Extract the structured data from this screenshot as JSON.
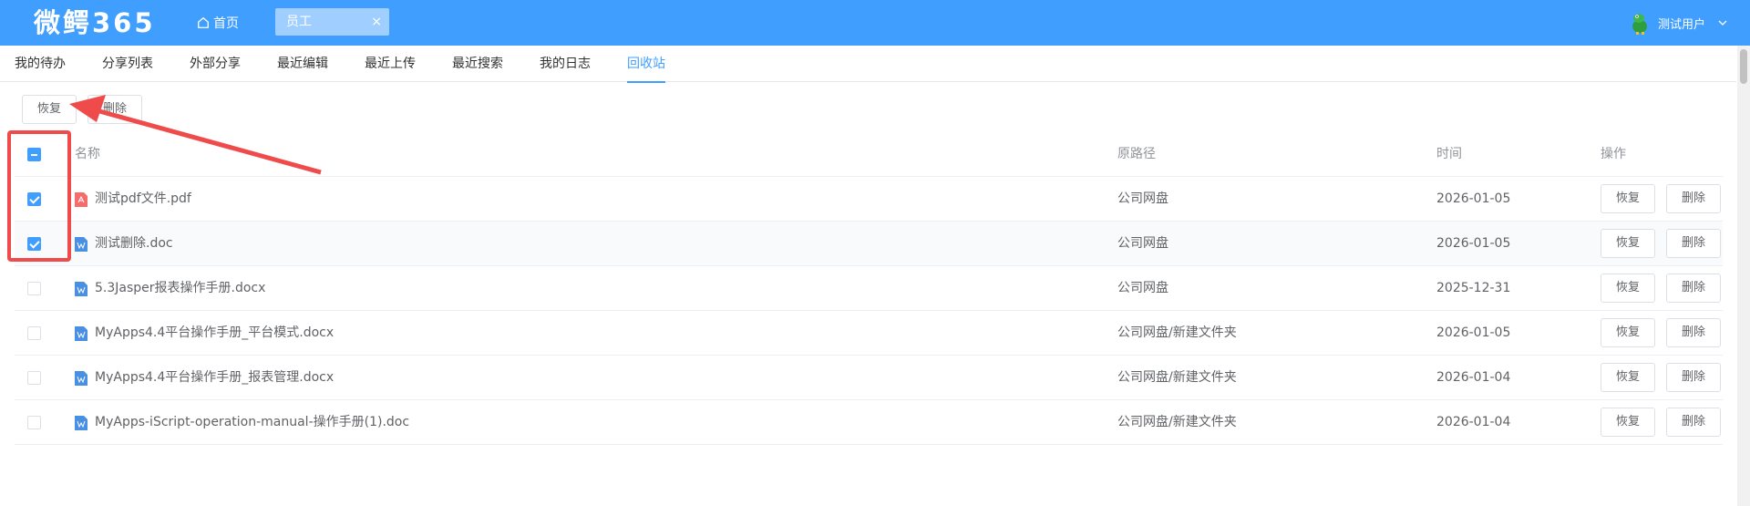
{
  "header": {
    "logo": "微鳄365",
    "home_label": "首页",
    "open_tab": {
      "label": "员工",
      "close_glyph": "×"
    },
    "user_name": "测试用户",
    "icons": [
      "home-icon",
      "close-icon",
      "avatar-crocodile",
      "chevron-down-icon"
    ]
  },
  "nav": {
    "tabs": [
      "我的待办",
      "分享列表",
      "外部分享",
      "最近编辑",
      "最近上传",
      "最近搜索",
      "我的日志",
      "回收站"
    ],
    "active": "回收站"
  },
  "toolbar": {
    "restore_label": "恢复",
    "delete_label": "删除"
  },
  "table": {
    "columns": {
      "name": "名称",
      "path": "原路径",
      "time": "时间",
      "ops": "操作"
    },
    "header_checkbox": "indeterminate",
    "rows": [
      {
        "name": "测试pdf文件.pdf",
        "type": "pdf",
        "path": "公司网盘",
        "time": "2026-01-05",
        "checked": true,
        "restore": "恢复",
        "delete": "删除"
      },
      {
        "name": "测试删除.doc",
        "type": "word",
        "path": "公司网盘",
        "time": "2026-01-05",
        "checked": true,
        "restore": "恢复",
        "delete": "删除"
      },
      {
        "name": "5.3Jasper报表操作手册.docx",
        "type": "word",
        "path": "公司网盘",
        "time": "2025-12-31",
        "checked": false,
        "restore": "恢复",
        "delete": "删除"
      },
      {
        "name": "MyApps4.4平台操作手册_平台模式.docx",
        "type": "word",
        "path": "公司网盘/新建文件夹",
        "time": "2026-01-05",
        "checked": false,
        "restore": "恢复",
        "delete": "删除"
      },
      {
        "name": "MyApps4.4平台操作手册_报表管理.docx",
        "type": "word",
        "path": "公司网盘/新建文件夹",
        "time": "2026-01-04",
        "checked": false,
        "restore": "恢复",
        "delete": "删除"
      },
      {
        "name": "MyApps-iScript-operation-manual-操作手册(1).doc",
        "type": "word",
        "path": "公司网盘/新建文件夹",
        "time": "2026-01-04",
        "checked": false,
        "restore": "恢复",
        "delete": "删除"
      }
    ]
  },
  "colors": {
    "primary": "#409eff",
    "annotation": "#f04b4b",
    "pdf": "#f56c6c",
    "word": "#4a90e2"
  }
}
